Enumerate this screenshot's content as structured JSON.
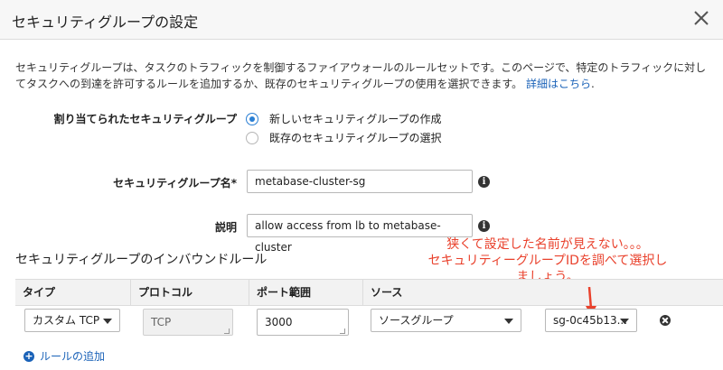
{
  "dialog": {
    "title": "セキュリティグループの設定"
  },
  "description": {
    "text": "セキュリティグループは、タスクのトラフィックを制御するファイアウォールのルールセットです。このページで、特定のトラフィックに対してタスクへの到達を許可するルールを追加するか、既存のセキュリティグループの使用を選択できます。",
    "link_label": "詳細はこちら",
    "trailing": "."
  },
  "assign": {
    "label": "割り当てられたセキュリティグループ",
    "options": [
      {
        "label": "新しいセキュリティグループの作成",
        "checked": true
      },
      {
        "label": "既存のセキュリティグループの選択",
        "checked": false
      }
    ]
  },
  "group_name": {
    "label": "セキュリティグループ名*",
    "value": "metabase-cluster-sg"
  },
  "description_field": {
    "label": "説明",
    "value": "allow access from lb to metabase-cluster"
  },
  "inbound": {
    "title": "セキュリティグループのインバウンドルール",
    "columns": [
      "タイプ",
      "プロトコル",
      "ポート範囲",
      "ソース"
    ],
    "row": {
      "type": "カスタム TCP",
      "protocol": "TCP",
      "port": "3000",
      "source": "ソースグループ",
      "source_id": "sg-0c45b13..."
    },
    "add_label": "ルールの追加"
  },
  "annotation": {
    "lines": [
      "狭くて設定した名前が見えない。。。",
      "セキュリティーグループIDを調べて選択し",
      "ましょう。"
    ],
    "color": "#e9412c"
  },
  "colors": {
    "link": "#1a62b8",
    "radio_checked": "#2a7fd4"
  },
  "icons": [
    "close-icon",
    "info-icon",
    "remove-icon",
    "add-icon",
    "arrow-down-icon"
  ]
}
